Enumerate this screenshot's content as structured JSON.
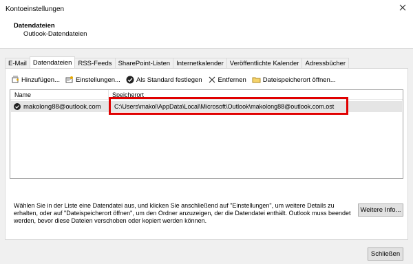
{
  "window": {
    "title": "Kontoeinstellungen"
  },
  "header": {
    "title": "Datendateien",
    "subtitle": "Outlook-Datendateien"
  },
  "tabs": [
    {
      "label": "E-Mail"
    },
    {
      "label": "Datendateien"
    },
    {
      "label": "RSS-Feeds"
    },
    {
      "label": "SharePoint-Listen"
    },
    {
      "label": "Internetkalender"
    },
    {
      "label": "Veröffentlichte Kalender"
    },
    {
      "label": "Adressbücher"
    }
  ],
  "toolbar": {
    "add_label": "Hinzufügen...",
    "settings_label": "Einstellungen...",
    "default_label": "Als Standard festlegen",
    "remove_label": "Entfernen",
    "open_location_label": "Dateispeicherort öffnen..."
  },
  "list": {
    "columns": {
      "name": "Name",
      "location": "Speicherort"
    },
    "rows": [
      {
        "name": "makolong88@outlook.com",
        "location": "C:\\Users\\makol\\AppData\\Local\\Microsoft\\Outlook\\makolong88@outlook.com.ost"
      }
    ]
  },
  "description": "Wählen Sie in der Liste eine Datendatei aus, und klicken Sie anschließend auf \"Einstellungen\", um weitere Details zu erhalten, oder auf \"Dateispeicherort öffnen\", um den Ordner anzuzeigen, der die Datendatei enthält. Outlook muss beendet werden, bevor diese Dateien verschoben oder kopiert werden können.",
  "buttons": {
    "more_info": "Weitere Info...",
    "close": "Schließen"
  },
  "colors": {
    "highlight": "#e00000",
    "selected_row": "#e5e5e5"
  }
}
